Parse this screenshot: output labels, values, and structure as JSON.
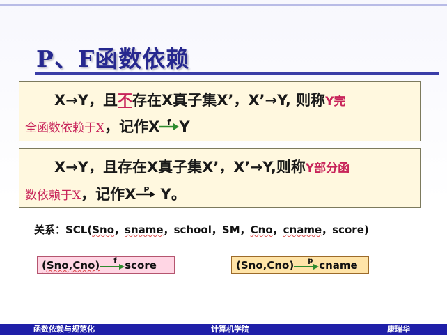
{
  "title": "P、F函数依赖",
  "box1": {
    "line1_a": "X→Y，且",
    "line1_not": "不",
    "line1_b": "存在X真子集X’，X’→Y, 则称",
    "line1_c": "Y完",
    "line2_a": "全函数依赖于X",
    "line2_b": "，记作X",
    "arrow_label": "f",
    "line2_c": "Y"
  },
  "box2": {
    "line1_a": "X→Y，且存在X真子集X’，X’→Y,则称",
    "line1_b": "Y部分函",
    "line2_a": "数依赖于X",
    "line2_b": "，记作X",
    "arrow_label": "P",
    "line2_c": "Y。"
  },
  "relation": {
    "prefix": "关系：SCL(",
    "attrs": [
      "Sno",
      "sname",
      "school",
      "SM",
      "Cno",
      "cname",
      "score"
    ],
    "sep": "，",
    "suffix": ")"
  },
  "example1": {
    "left": "(Sno,Cno)",
    "arrow_label": "f",
    "right": "score"
  },
  "example2": {
    "left": "(Sno,Cno)",
    "arrow_label": "p",
    "right": "cname"
  },
  "footer": {
    "left": "函数依赖与规范化",
    "center": "计算机学院",
    "right": "康瑞华"
  },
  "colors": {
    "title": "#26288f",
    "accent": "#c8245a",
    "arrow": "#2e8b2e",
    "footer": "#1f1fa8"
  }
}
